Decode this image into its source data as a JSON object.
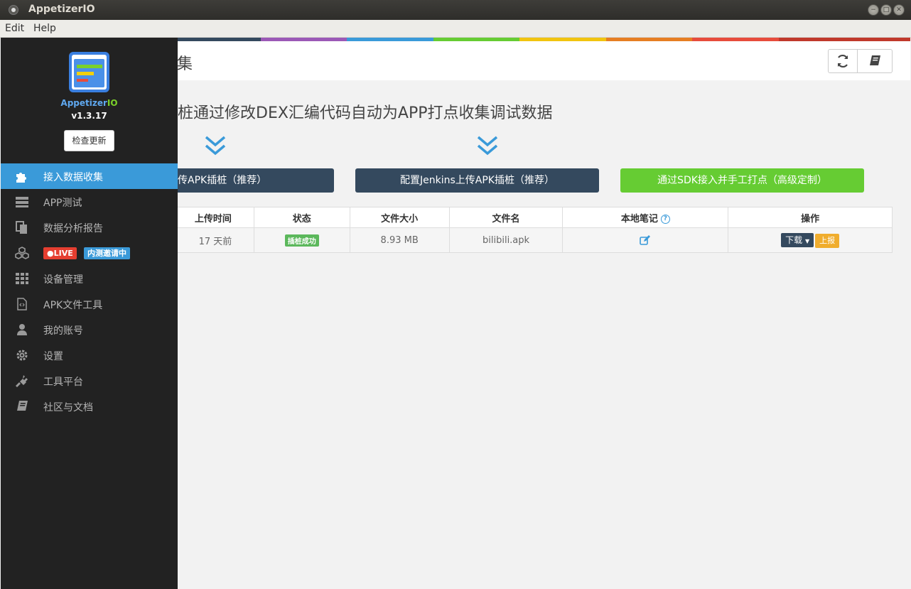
{
  "window": {
    "title": "AppetizerIO",
    "close": "✕",
    "minimize": "−",
    "maximize": "□"
  },
  "menu": {
    "items": [
      "Edit",
      "Help"
    ]
  },
  "sidebar": {
    "brand_main": "Appetizer",
    "brand_suffix": "IO",
    "version": "v1.3.17",
    "update_button": "检查更新",
    "items": [
      {
        "label": "接入数据收集",
        "icon": "puzzle-icon",
        "active": true
      },
      {
        "label": "APP测试",
        "icon": "server-icon"
      },
      {
        "label": "数据分析报告",
        "icon": "files-icon"
      },
      {
        "label": "",
        "icon": "cubes-icon"
      },
      {
        "label": "设备管理",
        "icon": "grid-icon"
      },
      {
        "label": "APK文件工具",
        "icon": "code-file-icon"
      },
      {
        "label": "我的账号",
        "icon": "user-icon"
      },
      {
        "label": "设置",
        "icon": "gear-icon"
      },
      {
        "label": "工具平台",
        "icon": "plug-icon"
      },
      {
        "label": "社区与文档",
        "icon": "book-icon"
      }
    ],
    "live_badge": "●LIVE",
    "beta_badge": "内测邀请中"
  },
  "main": {
    "colorbar": [
      "#34495e",
      "#9b59b6",
      "#3a9ad9",
      "#66cc33",
      "#f1c40f",
      "#e67e22",
      "#e74c3c",
      "#c0392b"
    ],
    "page_title": "集",
    "headline": "桩通过修改DEX汇编代码自动为APP打点收集调试数据",
    "buttons": {
      "upload": "传APK插桩（推荐）",
      "jenkins": "配置Jenkins上传APK插桩（推荐）",
      "sdk": "通过SDK接入并手工打点（高级定制）"
    },
    "table": {
      "headers": [
        "上传时间",
        "状态",
        "文件大小",
        "文件名",
        "本地笔记",
        "操作"
      ],
      "help": "?",
      "rows": [
        {
          "time": "17 天前",
          "status": "插桩成功",
          "size": "8.93 MB",
          "filename": "bilibili.apk",
          "download": "下载",
          "report": "上报"
        }
      ]
    }
  }
}
